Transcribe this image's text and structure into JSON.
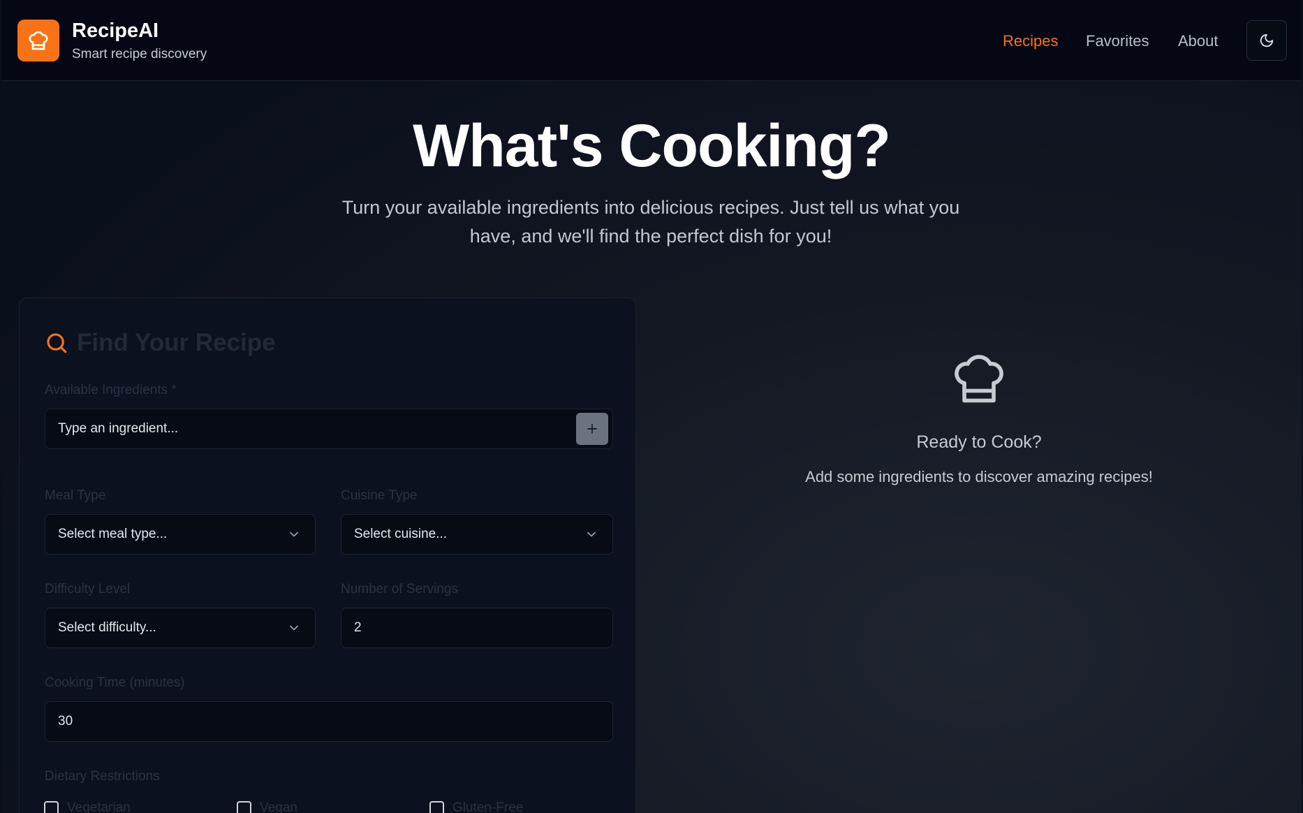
{
  "header": {
    "brand_title": "RecipeAI",
    "brand_subtitle": "Smart recipe discovery",
    "nav": [
      "Recipes",
      "Favorites",
      "About"
    ],
    "active_nav": "Recipes",
    "accent_color": "#f97316"
  },
  "hero": {
    "title": "What's Cooking?",
    "subtitle_line1": "Turn your available ingredients into delicious recipes. Just tell us what you",
    "subtitle_line2": "have, and we'll find the perfect dish for you!"
  },
  "form": {
    "title": "Find Your Recipe",
    "ingredients_label": "Available Ingredients *",
    "ingredients_placeholder": "Type an ingredient...",
    "meal_type_label": "Meal Type",
    "meal_type_value": "Select meal type...",
    "cuisine_label": "Cuisine Type",
    "cuisine_value": "Select cuisine...",
    "difficulty_label": "Difficulty Level",
    "difficulty_value": "Select difficulty...",
    "servings_label": "Number of Servings",
    "servings_value": "2",
    "time_label": "Cooking Time (minutes)",
    "time_value": "30",
    "dietary_label": "Dietary Restrictions",
    "dietary_options": [
      "Vegetarian",
      "Vegan",
      "Gluten-Free"
    ]
  },
  "empty_state": {
    "title": "Ready to Cook?",
    "subtitle": "Add some ingredients to discover amazing recipes!",
    "icon": "chef-hat-icon"
  }
}
